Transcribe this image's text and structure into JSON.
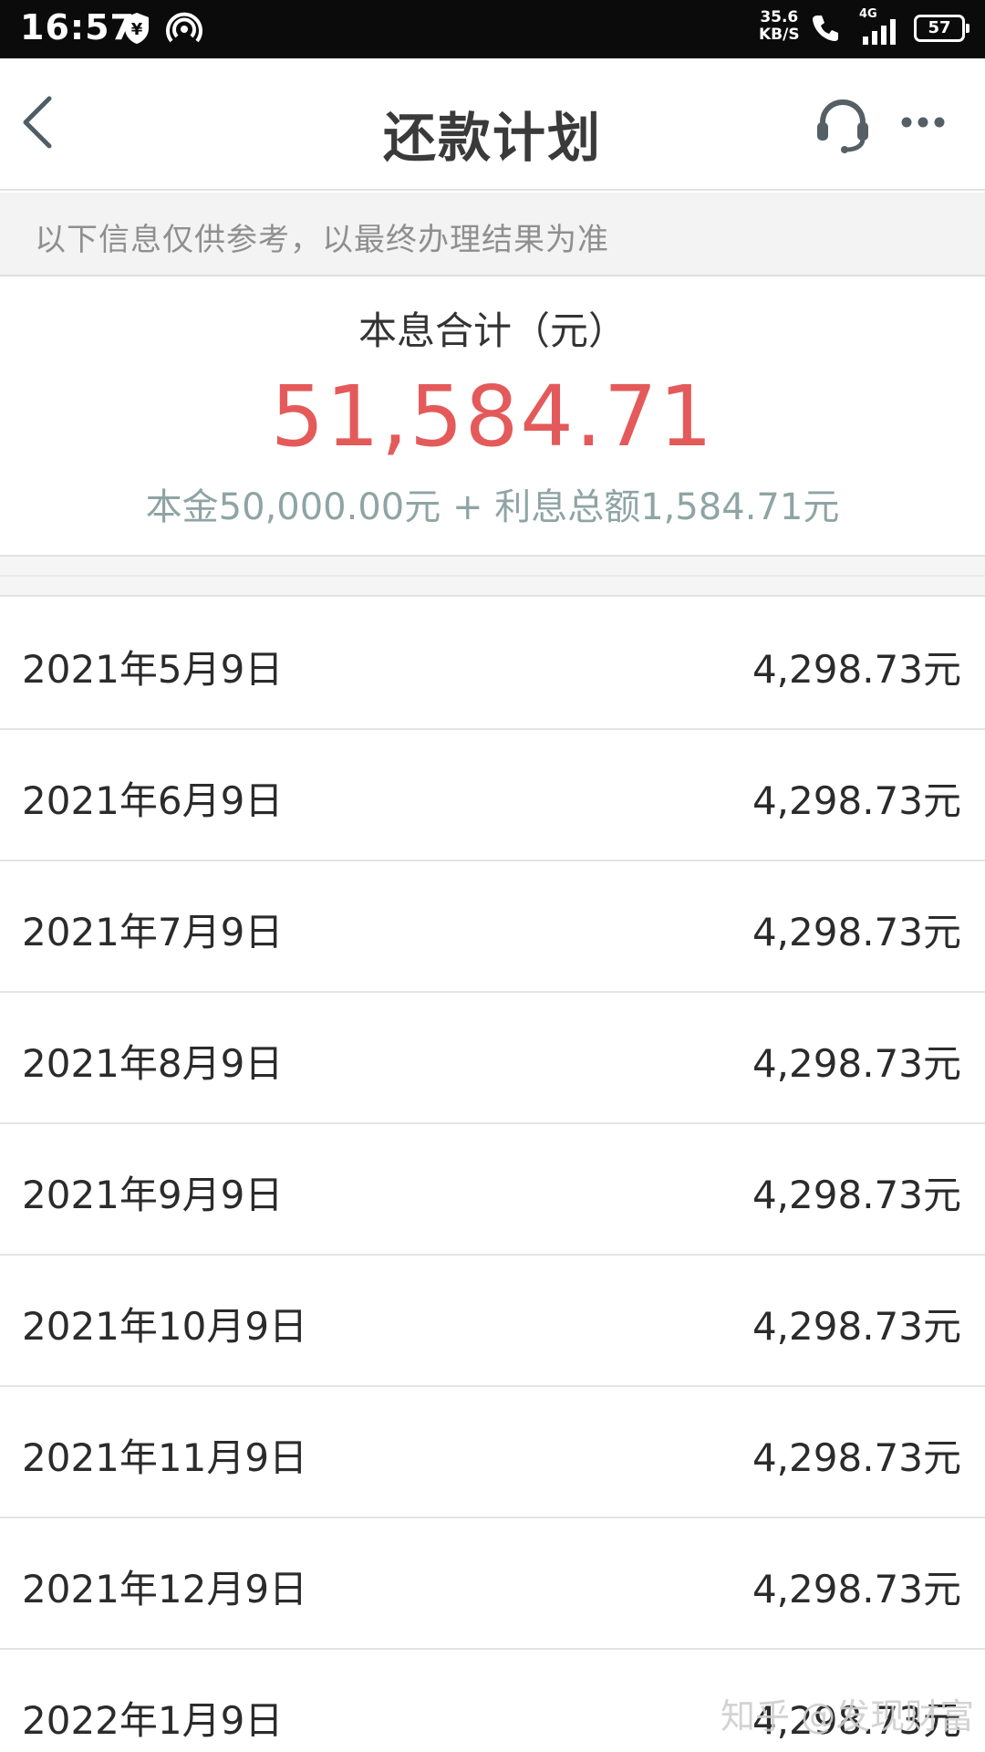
{
  "status_bar": {
    "time": "16:57",
    "speed_value": "35.6",
    "speed_unit": "KB/S",
    "network": "4G",
    "battery": "57",
    "icons": [
      "yuan-shield-icon",
      "hotspot-icon",
      "call-icon",
      "signal-icon",
      "battery-icon"
    ]
  },
  "nav": {
    "title": "还款计划",
    "icons": [
      "back-icon",
      "headset-icon",
      "more-icon"
    ]
  },
  "notice": {
    "text": "以下信息仅供参考，以最终办理结果为准"
  },
  "summary": {
    "label": "本息合计（元）",
    "total": "51,584.71",
    "breakdown": "本金50,000.00元 + 利息总额1,584.71元"
  },
  "schedule": [
    {
      "date": "2021年5月9日",
      "amount": "4,298.73元"
    },
    {
      "date": "2021年6月9日",
      "amount": "4,298.73元"
    },
    {
      "date": "2021年7月9日",
      "amount": "4,298.73元"
    },
    {
      "date": "2021年8月9日",
      "amount": "4,298.73元"
    },
    {
      "date": "2021年9月9日",
      "amount": "4,298.73元"
    },
    {
      "date": "2021年10月9日",
      "amount": "4,298.73元"
    },
    {
      "date": "2021年11月9日",
      "amount": "4,298.73元"
    },
    {
      "date": "2021年12月9日",
      "amount": "4,298.73元"
    },
    {
      "date": "2022年1月9日",
      "amount": "4,298.73元"
    }
  ],
  "watermark": "知乎 @发现财富"
}
